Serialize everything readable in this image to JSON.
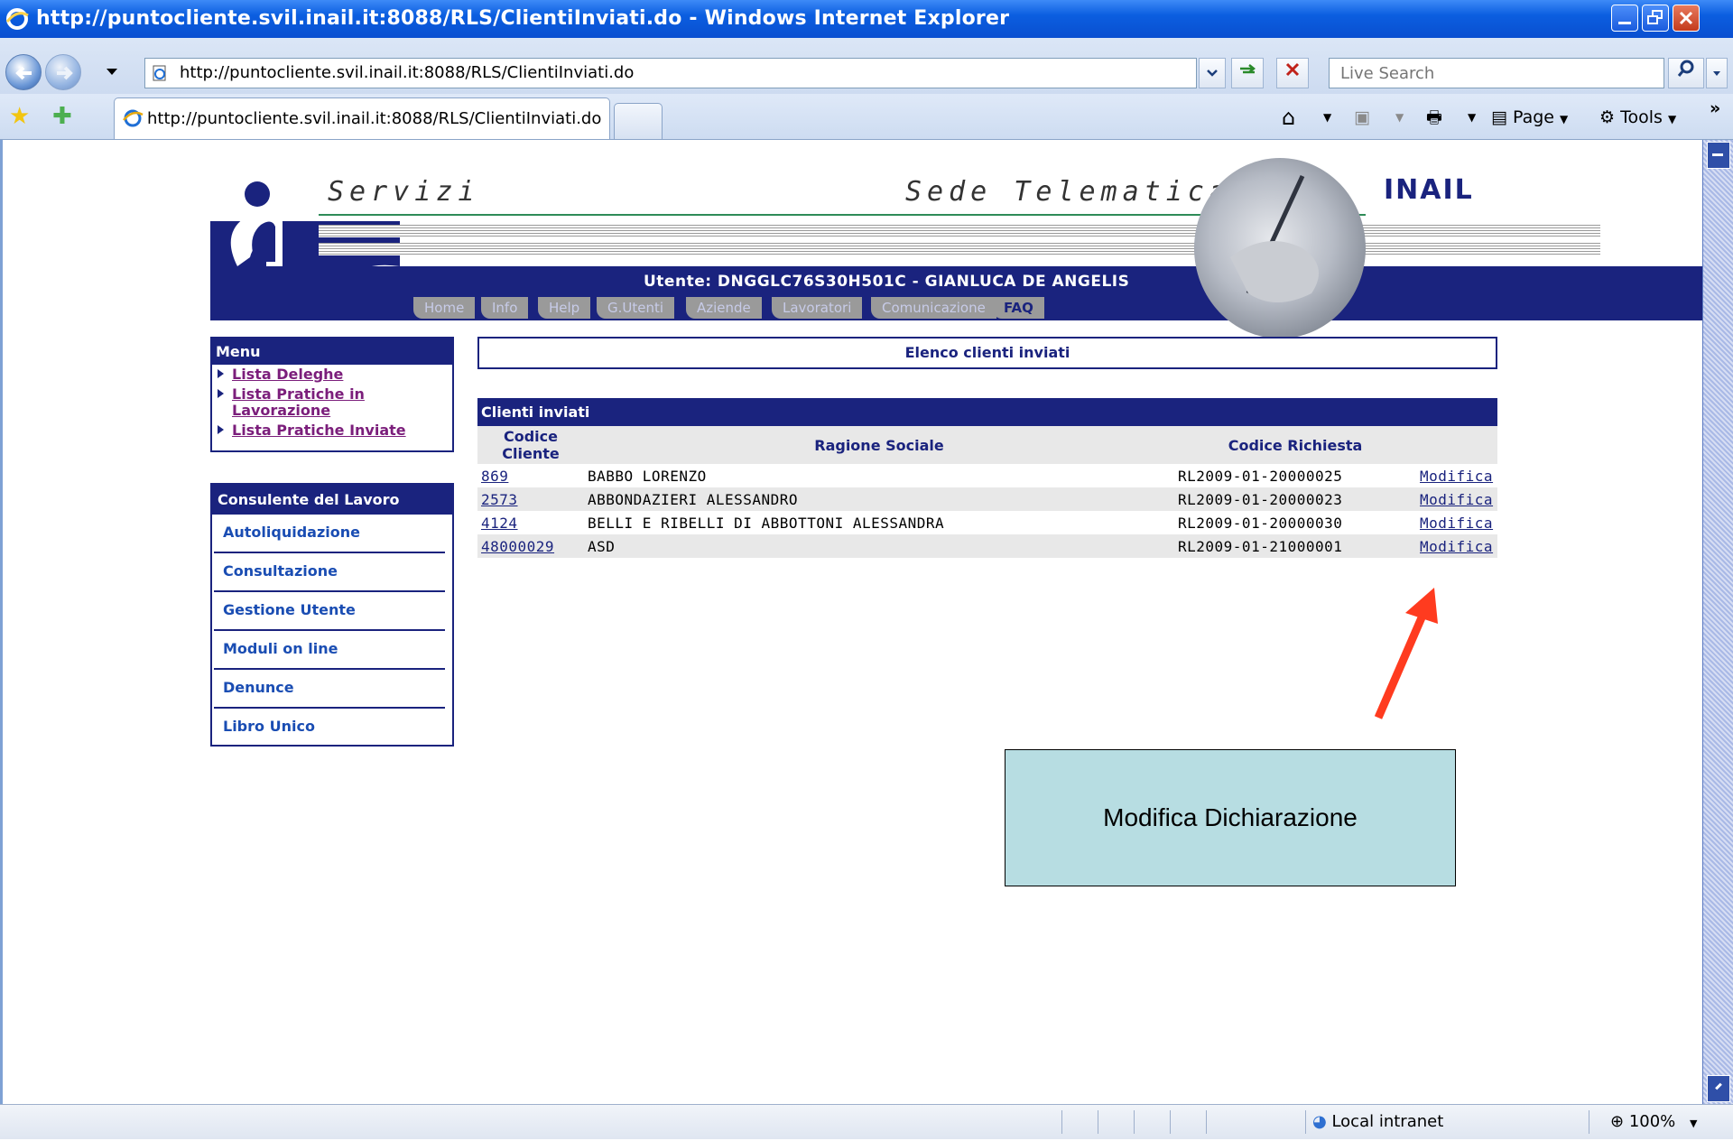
{
  "window": {
    "title": "http://puntocliente.svil.inail.it:8088/RLS/ClientiInviati.do - Windows Internet Explorer"
  },
  "address_bar": {
    "url": "http://puntocliente.svil.inail.it:8088/RLS/ClientiInviati.do",
    "search_placeholder": "Live Search"
  },
  "tab": {
    "title": "http://puntocliente.svil.inail.it:8088/RLS/ClientiInviati.do"
  },
  "command_bar": {
    "page_label": "Page",
    "tools_label": "Tools",
    "more": "»"
  },
  "banner": {
    "servizi": "Servizi",
    "sede": "Sede Telematica",
    "brand": "INAIL",
    "user": "Utente: DNGGLC76S30H501C - GIANLUCA DE ANGELIS",
    "nav": [
      "Home",
      "Info",
      "Help",
      "G.Utenti",
      "Aziende",
      "Lavoratori",
      "Comunicazione",
      "FAQ"
    ]
  },
  "menu": {
    "header": "Menu",
    "items": [
      "Lista Deleghe",
      "Lista Pratiche in Lavorazione",
      "Lista Pratiche Inviate"
    ]
  },
  "consulente": {
    "header": "Consulente del Lavoro",
    "items": [
      "Autoliquidazione",
      "Consultazione",
      "Gestione Utente",
      "Moduli on line",
      "Denunce",
      "Libro Unico"
    ]
  },
  "content": {
    "title": "Elenco clienti inviati",
    "table_caption": "Clienti inviati",
    "columns": [
      "Codice Cliente",
      "Ragione Sociale",
      "Codice Richiesta",
      ""
    ],
    "rows": [
      {
        "codice": "869",
        "ragione": "BABBO LORENZO",
        "richiesta": "RL2009-01-20000025",
        "action": "Modifica"
      },
      {
        "codice": "2573",
        "ragione": "ABBONDAZIERI ALESSANDRO",
        "richiesta": "RL2009-01-20000023",
        "action": "Modifica"
      },
      {
        "codice": "4124",
        "ragione": "BELLI E RIBELLI DI ABBOTTONI ALESSANDRA",
        "richiesta": "RL2009-01-20000030",
        "action": "Modifica"
      },
      {
        "codice": "48000029",
        "ragione": "ASD",
        "richiesta": "RL2009-01-21000001",
        "action": "Modifica"
      }
    ]
  },
  "callout": {
    "text": "Modifica Dichiarazione",
    "arrow_color": "#ff3b1f"
  },
  "status_bar": {
    "zone": "Local intranet",
    "zoom": "100%"
  },
  "colors": {
    "brand_navy": "#1a237e",
    "titlebar_blue": "#0b5ee0",
    "callout_bg": "#b7dde2"
  }
}
